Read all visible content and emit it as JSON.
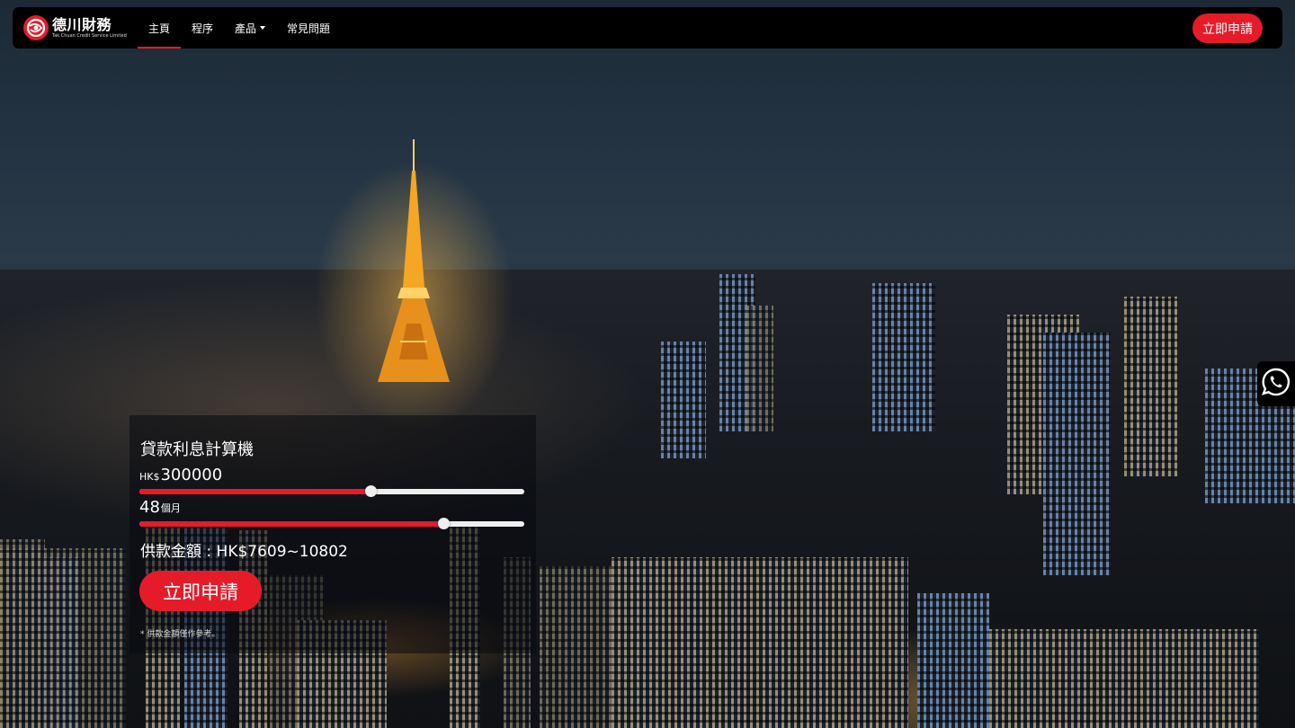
{
  "brand": {
    "name_cn": "德川財務",
    "name_en": "Tak Chuan Credit Service Limited",
    "color": "#e51b2a"
  },
  "nav": {
    "items": [
      {
        "label": "主頁",
        "active": true
      },
      {
        "label": "程序"
      },
      {
        "label": "產品",
        "dropdown": true
      },
      {
        "label": "常見問題"
      }
    ],
    "apply_label": "立即申請"
  },
  "calculator": {
    "title": "貸款利息計算機",
    "amount": {
      "currency": "HK$",
      "value": "300000",
      "fill_fraction": 0.6
    },
    "tenor": {
      "value": "48",
      "unit": "個月",
      "fill_fraction": 0.79
    },
    "payment_label": "供款金額 : HK$7609~10802",
    "apply_label": "立即申請",
    "note": "* 供款金額僅作參考。"
  },
  "icons": {
    "whatsapp": "whatsapp-icon",
    "logo": "logo-mark-icon"
  }
}
